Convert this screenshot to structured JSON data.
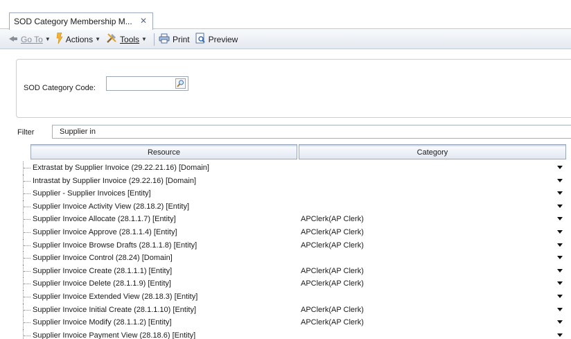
{
  "tab": {
    "title": "SOD Category Membership M...",
    "close": "✕"
  },
  "toolbar": {
    "goto_label": "Go To",
    "actions_label": "Actions",
    "tools_label": "Tools",
    "print_label": "Print",
    "preview_label": "Preview"
  },
  "form": {
    "code_label": "SOD Category Code:",
    "code_value": "",
    "filter_label": "Filter",
    "filter_value": "Supplier in"
  },
  "grid": {
    "columns": [
      "Resource",
      "Category"
    ],
    "rows": [
      {
        "resource": "Extrastat by Supplier Invoice (29.22.21.16) [Domain]",
        "category": ""
      },
      {
        "resource": "Intrastat by Supplier Invoice (29.22.16) [Domain]",
        "category": ""
      },
      {
        "resource": "Supplier - Supplier Invoices [Entity]",
        "category": ""
      },
      {
        "resource": "Supplier Invoice Activity View (28.18.2) [Entity]",
        "category": ""
      },
      {
        "resource": "Supplier Invoice Allocate (28.1.1.7) [Entity]",
        "category": "APClerk(AP Clerk)"
      },
      {
        "resource": "Supplier Invoice Approve (28.1.1.4) [Entity]",
        "category": "APClerk(AP Clerk)"
      },
      {
        "resource": "Supplier Invoice Browse Drafts (28.1.1.8) [Entity]",
        "category": "APClerk(AP Clerk)"
      },
      {
        "resource": "Supplier Invoice Control (28.24) [Domain]",
        "category": ""
      },
      {
        "resource": "Supplier Invoice Create (28.1.1.1) [Entity]",
        "category": "APClerk(AP Clerk)"
      },
      {
        "resource": "Supplier Invoice Delete (28.1.1.9) [Entity]",
        "category": "APClerk(AP Clerk)"
      },
      {
        "resource": "Supplier Invoice Extended View (28.18.3) [Entity]",
        "category": ""
      },
      {
        "resource": "Supplier Invoice Initial Create (28.1.1.10) [Entity]",
        "category": "APClerk(AP Clerk)"
      },
      {
        "resource": "Supplier Invoice Modify (28.1.1.2) [Entity]",
        "category": "APClerk(AP Clerk)"
      },
      {
        "resource": "Supplier Invoice Payment View (28.18.6) [Entity]",
        "category": ""
      }
    ]
  }
}
